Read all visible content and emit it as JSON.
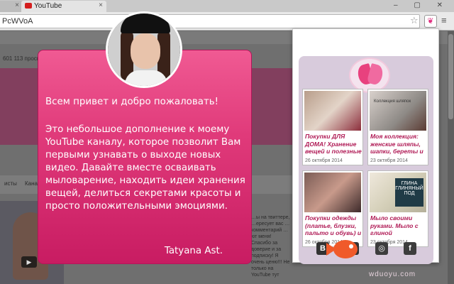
{
  "browser": {
    "tabs": [
      {
        "label": "",
        "active": false
      },
      {
        "label": "YouTube",
        "active": true
      }
    ],
    "url_text": "PcWVoA",
    "menu_icon": "hamburger-icon"
  },
  "page": {
    "views_text": "601 113 просм",
    "nav_label": "исты",
    "nav_label2": "Кана",
    "comment_lines": "…ы на твиттере, …ересует вас …комментарий …ют меня! Спасибо за доверие и за подписку! Я очень ценю!!! Не только на YouTube тут"
  },
  "welcome": {
    "greeting": "Всем привет и добро пожаловать!",
    "body": "Это небольшое дополнение к моему YouTube каналу, которое позволит Вам первыми узнавать о выходе новых видео. Давайте вместе осваивать мыловарение, находить идеи хранения вещей, делиться секретами красоты и просто положительными эмоциями.",
    "signature": "Tatyana Ast."
  },
  "panel": {
    "cards": [
      {
        "title": "Покупки ДЛЯ ДОМА! Хранение вещей и полезные",
        "date": "26 октября 2014"
      },
      {
        "title": "Моя коллекция: женские шляпы, шапки, береты и",
        "date": "23 октября 2014",
        "thumb_text": "Коллекция шляпок"
      },
      {
        "title": "Покупки одежды (платье, блузки, пальто и обувь) и",
        "date": "26 октября 2014"
      },
      {
        "title": "Мыло своими руками. Мыло с глиной",
        "date": "23 октября 2014",
        "thumb_text": "ГЛИНА ГЛИНЯНЫЙ ПОД"
      }
    ],
    "social_icons": [
      "vk-icon",
      "youtube-icon",
      "instagram-icon",
      "facebook-icon"
    ],
    "social_glyphs": {
      "vk": "B",
      "yt": "▶",
      "ig": "◎",
      "fb": "f"
    }
  },
  "watermark": "wduoyu.com"
}
